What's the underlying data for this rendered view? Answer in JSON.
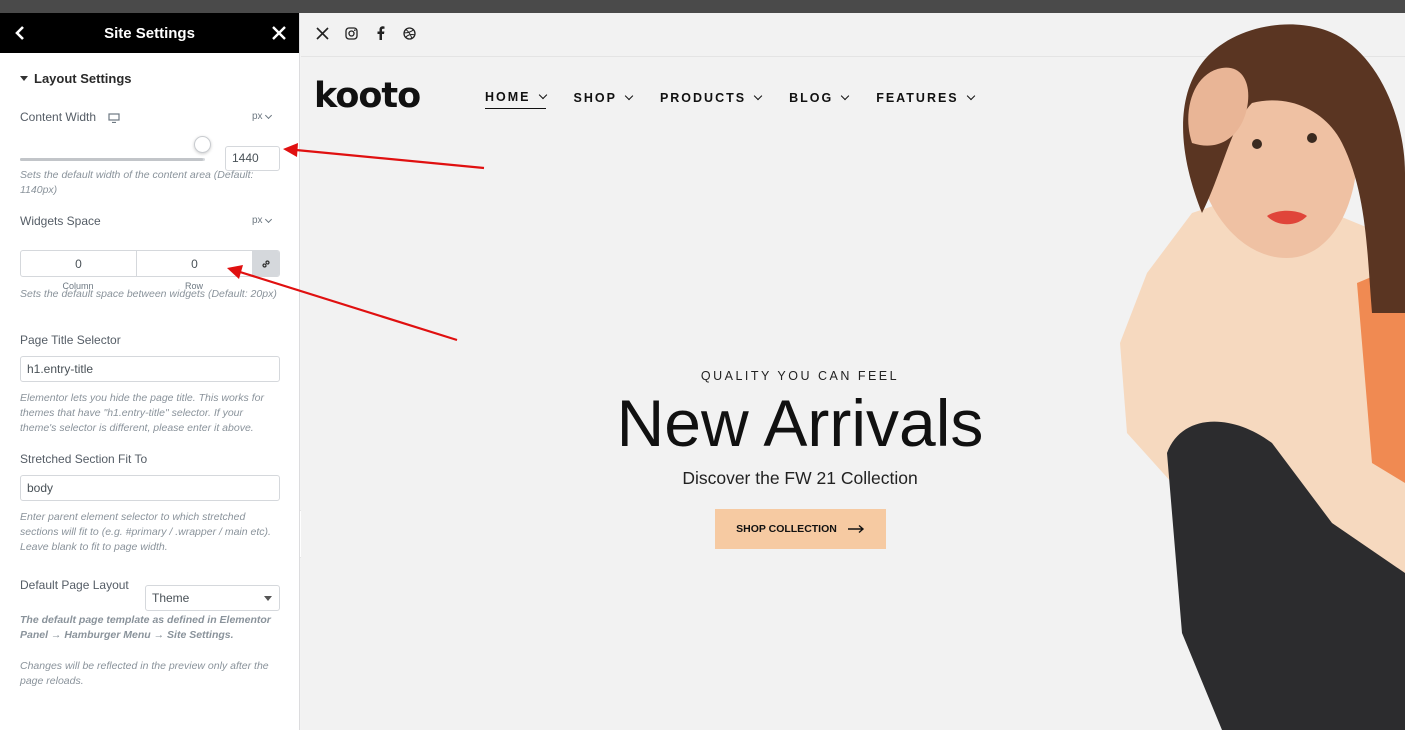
{
  "panel": {
    "title": "Site Settings",
    "section_title": "Layout Settings",
    "content_width": {
      "label": "Content Width",
      "unit": "px",
      "value": "1440",
      "slider_fraction": 0.99,
      "description": "Sets the default width of the content area (Default: 1140px)"
    },
    "widgets_space": {
      "label": "Widgets Space",
      "unit": "px",
      "column_value": "0",
      "row_value": "0",
      "column_label": "Column",
      "row_label": "Row",
      "description": "Sets the default space between widgets (Default: 20px)"
    },
    "page_title_selector": {
      "label": "Page Title Selector",
      "value": "h1.entry-title",
      "description": "Elementor lets you hide the page title. This works for themes that have \"h1.entry-title\" selector. If your theme's selector is different, please enter it above."
    },
    "stretched_section": {
      "label": "Stretched Section Fit To",
      "value": "body",
      "description": "Enter parent element selector to which stretched sections will fit to (e.g. #primary / .wrapper / main etc). Leave blank to fit to page width."
    },
    "default_page_layout": {
      "label": "Default Page Layout",
      "value": "Theme",
      "description": "The default page template as defined in Elementor Panel → Hamburger Menu → Site Settings."
    },
    "reload_note": "Changes will be reflected in the preview only after the page reloads."
  },
  "site": {
    "social_icons": [
      "x-icon",
      "instagram-icon",
      "facebook-icon",
      "dribbble-icon"
    ],
    "logo": "kooto",
    "nav": [
      {
        "label": "HOME",
        "active": true
      },
      {
        "label": "SHOP",
        "active": false
      },
      {
        "label": "PRODUCTS",
        "active": false
      },
      {
        "label": "BLOG",
        "active": false
      },
      {
        "label": "FEATURES",
        "active": false
      }
    ],
    "hero": {
      "eyebrow": "QUALITY YOU CAN FEEL",
      "headline": "New Arrivals",
      "subline": "Discover the FW 21 Collection",
      "cta": "SHOP COLLECTION"
    }
  },
  "colors": {
    "panel_header": "#000000",
    "cta_background": "#f6caa2",
    "annotation_arrow": "#e01010"
  }
}
